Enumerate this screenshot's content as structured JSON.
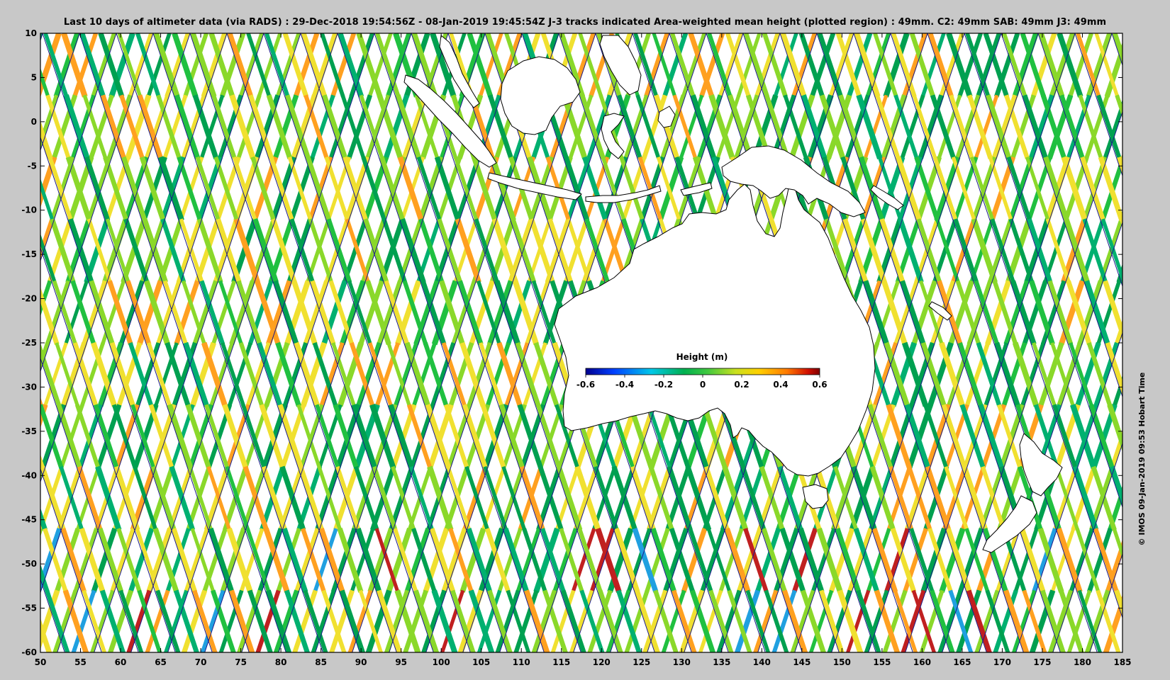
{
  "title": "Last 10 days of altimeter data (via RADS) : 29-Dec-2018 19:54:56Z - 08-Jan-2019 19:45:54Z  J-3 tracks indicated  Area-weighted mean height (plotted region) : 49mm.  C2: 49mm  SAB: 49mm  J3: 49mm",
  "credit": "© IMOS 09-Jan-2019 09:53 Hobart Time",
  "map": {
    "lon_range": [
      50,
      185
    ],
    "lat_range": [
      -60,
      10
    ],
    "x_ticks": [
      "50",
      "55",
      "60",
      "65",
      "70",
      "75",
      "80",
      "85",
      "90",
      "95",
      "100",
      "105",
      "110",
      "115",
      "120",
      "125",
      "130",
      "135",
      "140",
      "145",
      "150",
      "155",
      "160",
      "165",
      "170",
      "175",
      "180",
      "185"
    ],
    "y_ticks": [
      "10",
      "5",
      "0",
      "-5",
      "-10",
      "-15",
      "-20",
      "-25",
      "-30",
      "-35",
      "-40",
      "-45",
      "-50",
      "-55",
      "-60"
    ]
  },
  "colorbar": {
    "label": "Height (m)",
    "range": [
      -0.6,
      0.6
    ],
    "ticks": [
      "-0.6",
      "-0.4",
      "-0.2",
      "0",
      "0.2",
      "0.4",
      "0.6"
    ],
    "colors": [
      "#00008f",
      "#0050ff",
      "#00c8ff",
      "#00c060",
      "#3cc840",
      "#c8e628",
      "#ffd700",
      "#ff8c00",
      "#e02000",
      "#800000"
    ]
  },
  "colors": {
    "background": "#c8c8c8",
    "ocean_base": "#ffffff",
    "land": "#ffffff",
    "track_green": "#00a050",
    "track_lime": "#8ad82a",
    "track_yellow": "#f0e030",
    "track_orange": "#ffa020",
    "track_blue": "#1a1a8a"
  }
}
